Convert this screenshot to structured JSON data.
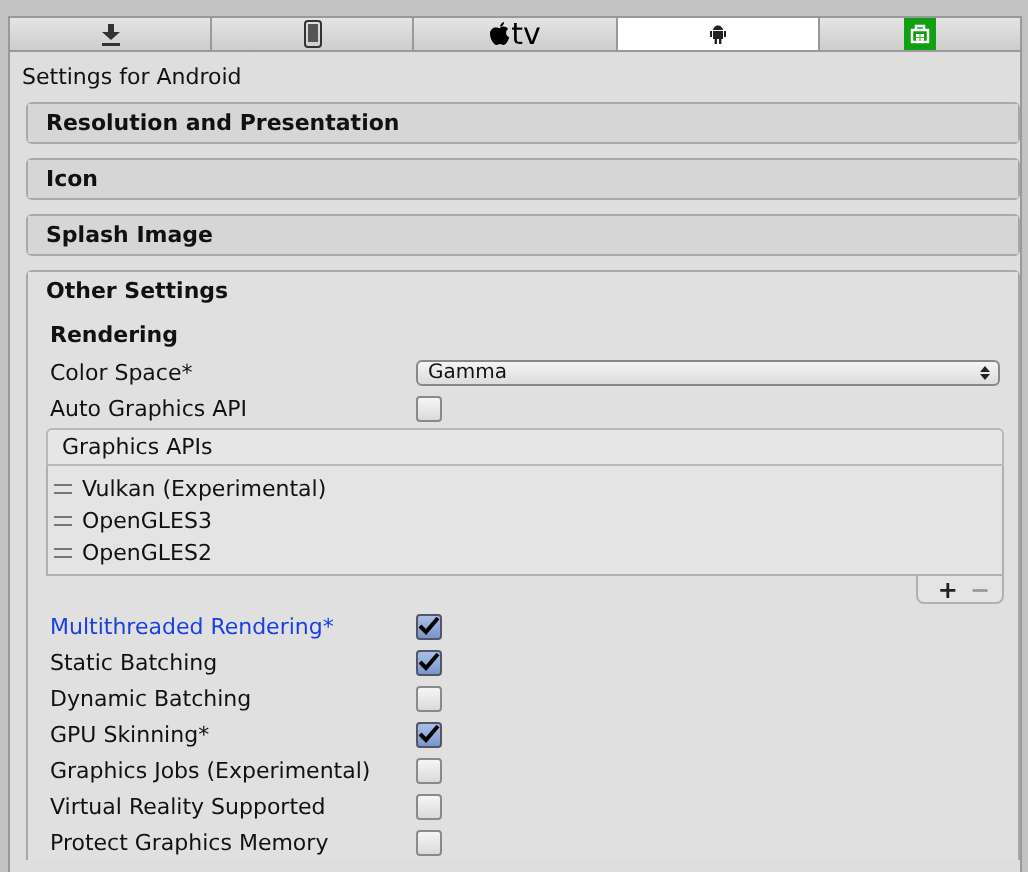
{
  "platform_tabs": [
    {
      "kind": "download",
      "selected": false
    },
    {
      "kind": "phone",
      "selected": false
    },
    {
      "kind": "tv",
      "label": "tv",
      "selected": false
    },
    {
      "kind": "android",
      "selected": true
    },
    {
      "kind": "store",
      "selected": false
    }
  ],
  "title": "Settings for Android",
  "sections": [
    {
      "label": "Resolution and Presentation",
      "expanded": false
    },
    {
      "label": "Icon",
      "expanded": false
    },
    {
      "label": "Splash Image",
      "expanded": false
    },
    {
      "label": "Other Settings",
      "expanded": true
    }
  ],
  "other_settings": {
    "heading": "Rendering",
    "color_space": {
      "label": "Color Space*",
      "value": "Gamma"
    },
    "auto_graphics_api": {
      "label": "Auto Graphics API",
      "checked": false
    },
    "graphics_apis": {
      "header": "Graphics APIs",
      "items": [
        "Vulkan (Experimental)",
        "OpenGLES3",
        "OpenGLES2"
      ],
      "add": "+",
      "remove": "−"
    },
    "options": [
      {
        "label": "Multithreaded Rendering*",
        "checked": true,
        "highlighted": true
      },
      {
        "label": "Static Batching",
        "checked": true,
        "highlighted": false
      },
      {
        "label": "Dynamic Batching",
        "checked": false,
        "highlighted": false
      },
      {
        "label": "GPU Skinning*",
        "checked": true,
        "highlighted": false
      },
      {
        "label": "Graphics Jobs (Experimental)",
        "checked": false,
        "highlighted": false
      },
      {
        "label": "Virtual Reality Supported",
        "checked": false,
        "highlighted": false
      },
      {
        "label": "Protect Graphics Memory",
        "checked": false,
        "highlighted": false
      }
    ]
  }
}
